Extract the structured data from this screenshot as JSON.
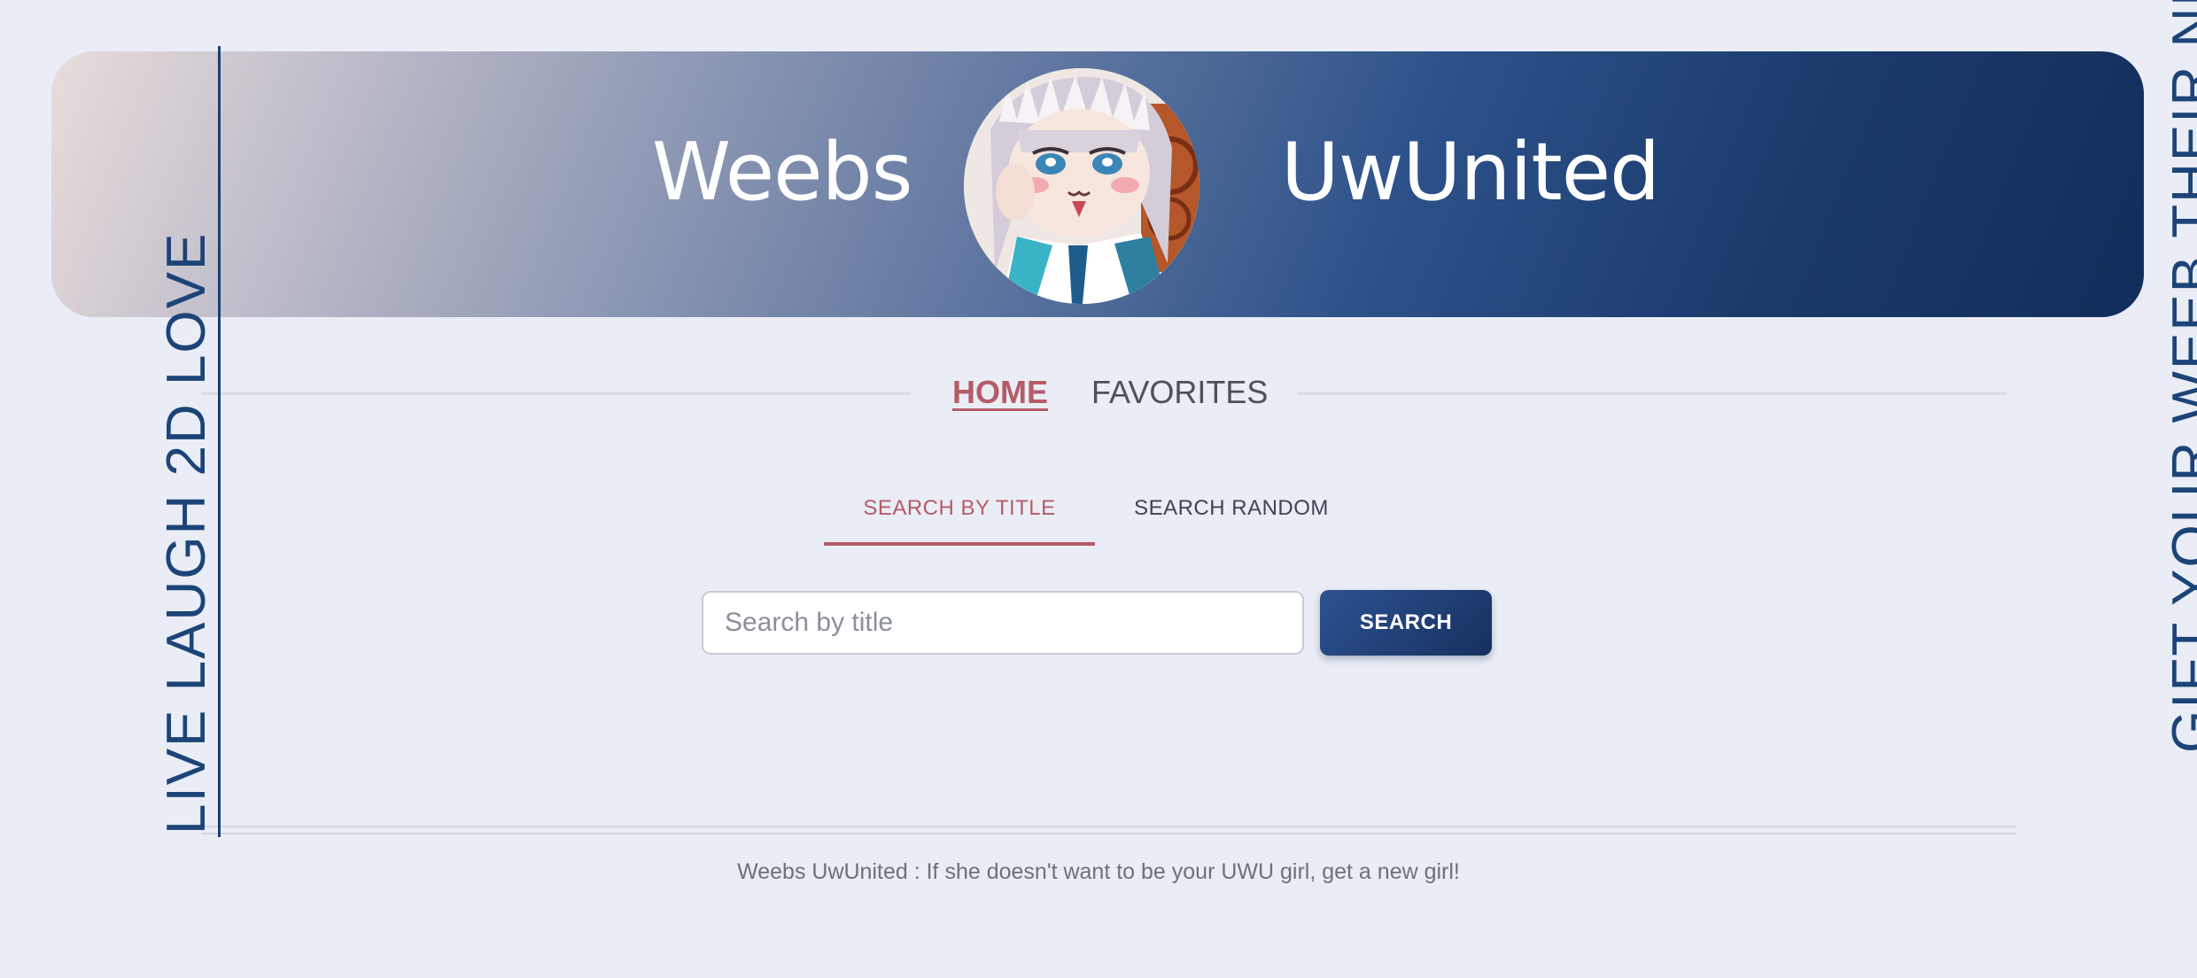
{
  "header": {
    "brand_left": "Weebs",
    "brand_right": "UwUnited",
    "avatar_icon": "anime-girl-avatar"
  },
  "side": {
    "left_slogan": "LIVE LAUGH 2D LOVE",
    "right_slogan": "GIFT YOUR WEEB THEIR NEE"
  },
  "nav": {
    "home": "HOME",
    "favorites": "FAVORITES",
    "active": "HOME"
  },
  "search": {
    "tabs": [
      {
        "label": "SEARCH BY TITLE",
        "active": true
      },
      {
        "label": "SEARCH RANDOM",
        "active": false
      }
    ],
    "placeholder": "Search by title",
    "value": "",
    "button_label": "SEARCH"
  },
  "footer": {
    "text": "Weebs UwUnited : If she doesn't want to be your UWU girl, get a new girl!"
  },
  "colors": {
    "background": "#eaedf5",
    "accent_red": "#b45c68",
    "navy": "#1c3f74",
    "banner_start": "#e8dcdc",
    "banner_end": "#122d5c"
  }
}
